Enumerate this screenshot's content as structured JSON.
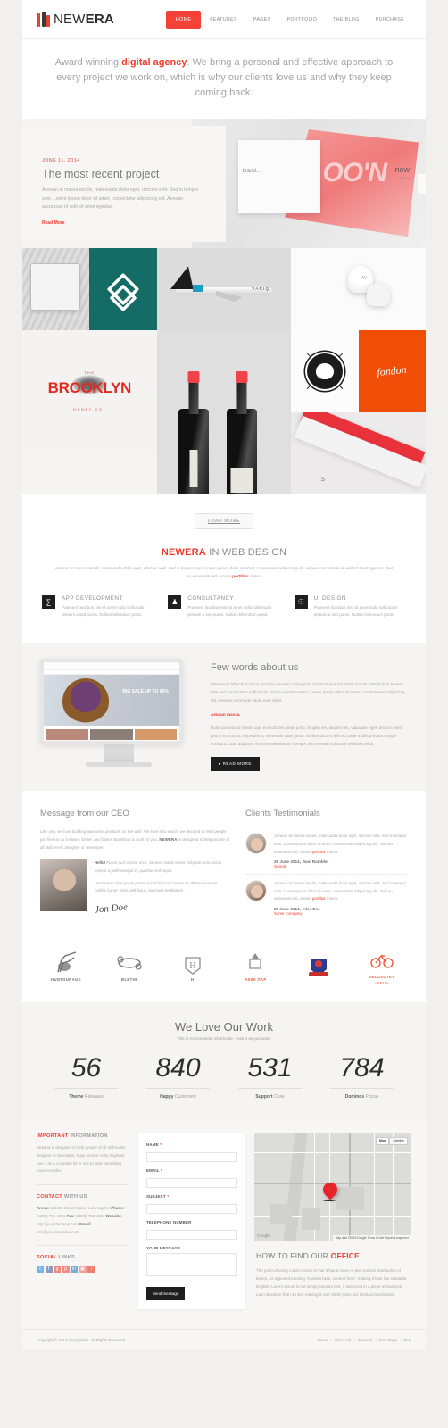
{
  "brand": {
    "name_light": "NEW",
    "name_bold": "ERA",
    "accent": "#ef3d2e",
    "dark": "#1e1e1e"
  },
  "nav": {
    "items": [
      {
        "label": "HOME",
        "active": true
      },
      {
        "label": "FEATURES",
        "active": false
      },
      {
        "label": "PAGES",
        "active": false
      },
      {
        "label": "PORTFOLIO",
        "active": false
      },
      {
        "label": "THE BLOG",
        "active": false
      },
      {
        "label": "PURCHASE",
        "active": false
      }
    ]
  },
  "tagline": {
    "pre": "Award winning ",
    "highlight": "digital agency",
    "post": ". We bring a personal and effective approach to every project we work on, which is why our clients love us and why they keep coming back."
  },
  "slider": {
    "date": "JUNE 11, 2014",
    "title": "The most recent project",
    "text": "Aenean at massa iaculis, malesuada dolor eget, ultricies velit. Sed in tempor sem. Lorem ipsum dolor sit amet, consectetur adipiscing elit. Aenean accumsan id velit sit amet egestas.",
    "read_more": "Read More",
    "image_labels": {
      "brand": "brand...",
      "ghost": "OO'N",
      "new": "new",
      "small": "we saw"
    }
  },
  "portfolio": {
    "items": [
      {
        "name": "sketch-notebook"
      },
      {
        "name": "teal-diamond-logo"
      },
      {
        "name": "varig-airplane",
        "caption": "VARIQ"
      },
      {
        "name": "boxing-gloves",
        "caption": "AV"
      },
      {
        "name": "brooklyn-honey",
        "the": "THE",
        "title": "BROOKLYN",
        "sub": "HONEY CO."
      },
      {
        "name": "wine-bottles"
      },
      {
        "name": "lion-crest-badge"
      },
      {
        "name": "fondon-orange",
        "caption": "fondon"
      },
      {
        "name": "red-ribbon-print",
        "caption": "S"
      }
    ]
  },
  "load_more": "LOAD MORE",
  "services": {
    "heading_red": "NEWERA",
    "heading_rest": " IN WEB DESIGN",
    "sub_pre": "Aenean at massa iaculis, malesuada dolor eget, ultricies velit. Sed in tempor sem. Lorem ipsum dolor sit amet, consectetur adipiscing elit. Aenean accumsan id velit sit amet egestas. Sed eu venenatis nisl, ornare ",
    "sub_link": "porttitor",
    "sub_post": " metus.",
    "items": [
      {
        "icon": "bank-icon",
        "glyph": "ἽB",
        "title": "APP DEVELOPMENT",
        "text": "Praesent faucibus nisl sit amet nulla sollicitudin pretium a sed purus. Nullam bibendum porta."
      },
      {
        "icon": "person-icon",
        "glyph": "♟",
        "title": "CONSULTANCY",
        "text": "Praesent faucibus nisl sit amet nulla sollicitudin pretium a sed purus. Nullam bibendum porta."
      },
      {
        "icon": "lightbulb-icon",
        "glyph": "⚲",
        "title": "UI DESIGN",
        "text": "Praesent faucibus nisl sit amet nulla sollicitudin pretium a sed purus. Nullam bibendum porta."
      }
    ]
  },
  "about": {
    "title": "Few words about us",
    "p1": "Maecenas bibendum lacus gravida placerat consequat. Vivamus quis hendrerit mauris. Vestibulum laoreet felis sed consectetur sollicitudin. Sed a mauris massa. Lorem ipsum dolor sit amet, consectetuer adipiscing elit. Aenean commodo ligula eget dolor.",
    "accent": "Aenean massa.",
    "p2": "Nulla consequat massa quis enim.Donec pede justo, fringilla vel, aliquet nec, vulputate eget, arcu.In enim justo, rhoncus ut, imperdiet a, venenatis vitae, justo. Nullam dictum felis eu pede mollis pretium.Integer tincidunt. Cras dapibus. Vivamus elementum semper nisi.Aenean vulputate eleifend tellus.",
    "button": "▸ READ MORE",
    "monitor_caption": "BIG SALE UP TO 60%"
  },
  "ceo": {
    "title": "Message from our CEO",
    "intro_pre": "Like you, we love building awesome products on the web. We love it so much, we decided to help people just like us do it easier, better, and faster. Bootstrap is built for you. ",
    "intro_brand": "NEWERA",
    "intro_post": " is designed to help people of all skill levels designer or developer.",
    "quote_lead": "Hello!",
    "quote1": " Fusce quis ornare arcu, sit amet mattis lorem. Aliquam urna lectus, tempor a pellentesque in, pulvinar sed turpis.",
    "quote2": "Vestibulum ante ipsum primis in faucibus orci luctus et ultrices posuere cubilia Curae; Nam velit lacus, euismod vestibulum .",
    "signature": "Jon Doe"
  },
  "testimonials": {
    "title": "Clients Testimonials",
    "items": [
      {
        "text_pre": "Aenean at massa iaculis, malesuada dolor eget, ultricies velit. Sed in tempor sem. Lorem ipsum dolor sit amet, consectetur adipiscing elit. Sed eu venenatis nisl, ornare ",
        "text_link": "porttitor",
        "text_post": " metus.",
        "date": "26 June 2014,",
        "author": "Ivan Rambler",
        "company": "Google"
      },
      {
        "text_pre": "Aenean at massa iaculis, malesuada dolor eget, ultricies velit. Sed in tempor sem. Lorem ipsum dolor sit amet, consectetur adipiscing elit. Sed eu venenatis nisl, ornare ",
        "text_link": "porttitor",
        "text_post": " metus.",
        "date": "25 June 2014,",
        "author": "Alex Doe",
        "company": "Some Company"
      }
    ]
  },
  "clients": [
    {
      "name": "HUNTOURAGE",
      "sub": ""
    },
    {
      "name": "BLETHI",
      "sub": ""
    },
    {
      "name": "H",
      "sub": ""
    },
    {
      "name": "АККИ ПАР",
      "sub": ""
    },
    {
      "name": "",
      "sub": ""
    },
    {
      "name": "VELOSOTKA",
      "sub": "ODESSA"
    }
  ],
  "achievements": {
    "title": "We Love Our Work",
    "subtitle": "This is Achivements Shortcode – use it as you want.",
    "items": [
      {
        "value": "56",
        "label_bold": "Theme",
        "label_rest": " Releases"
      },
      {
        "value": "840",
        "label_bold": "Happy",
        "label_rest": " Customers"
      },
      {
        "value": "531",
        "label_bold": "Support",
        "label_rest": " Case"
      },
      {
        "value": "784",
        "label_bold": "Dominos",
        "label_rest": " Pizzas"
      }
    ]
  },
  "footer": {
    "important": {
      "title_bold": "IMPORTANT",
      "title_rest": " INFORMATION",
      "text": "NewEra is designed to help people of all skill levels designer or developer, huge nerd or early beginner. Use it as a complete kit or use to start something more complex."
    },
    "contact": {
      "title_bold": "CONTACT",
      "title_rest": " WITH US",
      "l1_label": "Arena:",
      "l1_value": " 123456 Street Name, Los Angeles ",
      "l2_label": "Phone:",
      "l2_value": " (1800) 765-4321 ",
      "l3_label": "Fax:",
      "l3_value": " (1800) 765-4321 ",
      "l4_label": "Website:",
      "l4_value": " http://yoursitename.com ",
      "l5_label": "Email:",
      "l5_value": " info@yoursitename.com"
    },
    "social": {
      "title_bold": "SOCIAL",
      "title_rest": " LINKS",
      "icons": [
        {
          "name": "twitter-icon",
          "glyph": "t",
          "color": "#74b6e8"
        },
        {
          "name": "facebook-icon",
          "glyph": "f",
          "color": "#8b9dc3"
        },
        {
          "name": "googleplus-icon",
          "glyph": "g",
          "color": "#f08b82"
        },
        {
          "name": "pinterest-icon",
          "glyph": "p",
          "color": "#f08b82"
        },
        {
          "name": "linkedin-icon",
          "glyph": "in",
          "color": "#7aa8cf"
        },
        {
          "name": "instagram-icon",
          "glyph": "▣",
          "color": "#f0a1a1"
        },
        {
          "name": "rss-icon",
          "glyph": "◔",
          "color": "#f07f6e"
        }
      ]
    }
  },
  "form": {
    "fields": [
      {
        "name": "name-field",
        "label": "NAME",
        "required": "*",
        "value": "",
        "type": "input"
      },
      {
        "name": "email-field",
        "label": "EMAIL",
        "required": "*",
        "value": "",
        "type": "input"
      },
      {
        "name": "subject-field",
        "label": "SUBJECT",
        "required": "*",
        "value": "",
        "type": "input"
      },
      {
        "name": "telephone-field",
        "label": "TELEPHONE NUMBER",
        "required": "",
        "value": "",
        "type": "input"
      },
      {
        "name": "message-field",
        "label": "YOUR MESSAGE",
        "required": "",
        "value": "",
        "type": "textarea"
      }
    ],
    "submit": "Send message"
  },
  "map": {
    "control_map": "Map",
    "control_satellite": "Satellite",
    "attribution": "Map data ©2015 Google      Terms of Use      Report a map error",
    "logo": "Google"
  },
  "office": {
    "title_pre": "HOW TO FIND OUR ",
    "title_bold": "OFFICE",
    "text": "The point of using Lorem Ipsum is that it has a more-or-less normal distribution of letters, as opposed to using 'Content here, content here', making it look like readable English. Lorem Ipsum is not simply random text, it has roots in a piece of classical Latin literature from 45 BC, making it over 2000 years old. Richard McClintock"
  },
  "bottom": {
    "copyright": "Copyright © 2014 Orangeidea. All Rights Reserved.",
    "links": [
      "Home",
      "About US",
      "Services",
      "FAQ Page",
      "Blog"
    ],
    "sep": "/"
  }
}
